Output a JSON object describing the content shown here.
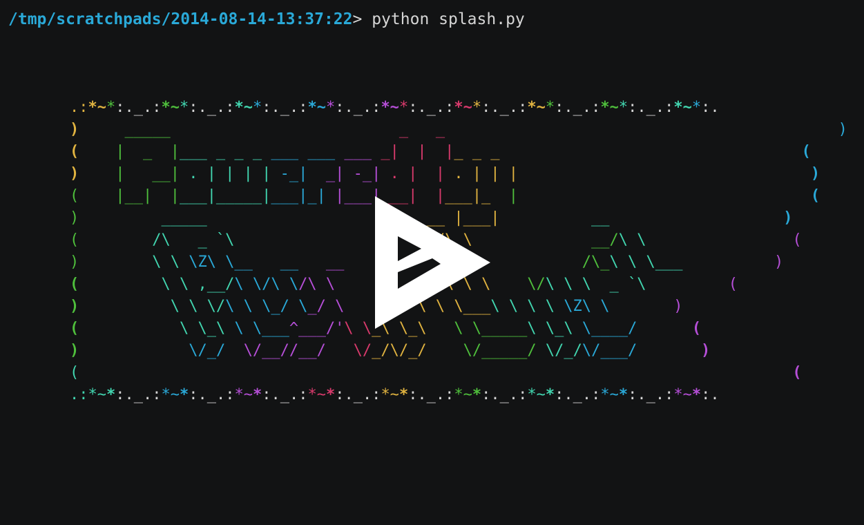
{
  "terminal": {
    "prompt_path": "/tmp/scratchpads/2014-08-14-13:37:22",
    "prompt_symbol": "> ",
    "command": "python splash.py"
  },
  "art": {
    "lines": [
      ".:*~*:._.:*~*:._.:*~*:._.:*~*:._.:*~*:._.:*~*:._.:*~*:._.:*~*:._.:*~*:.",
      ")     _____                             _   _                              )",
      "(    |  _  |___ _ _ _ ___ ___ ___ _|  |  |_ _ _                           (",
      ")    |   __| . | | | | -_|  _| -_| . |  | . | | |                          )",
      "(    |__|  |___|_____|___|_| |___|___|  |___|_  |                          (",
      ")         _____                              __ |___|          __          )",
      "(        /\\   _ `\\                          /\\ \\             __/\\ \\         (",
      ")        \\ \\ \\Z\\ \\__   __   __   __   __    \\ \\ \\           /\\_\\ \\ \\___     )",
      "(         \\ \\ ,__/\\ \\/\\ \\/\\ \\/\\ \\/\\ \\/\\ \\    \\ \\ \\    __  \\/\\ \\ \\  _ `\\   (",
      ")          \\ \\ \\/\\ \\ \\_/ \\_/ \\ \\ \\/\\ \\/\\ \\    \\ \\ \\___\\ \\ \\ \\ \\ \\Z\\ \\  )",
      "(           \\ \\_\\ \\ \\___^___/'\\ \\_\\ \\_\\ \\_\\    \\ \\_____\\ \\_\\ \\____/  (",
      ")            \\/_/  \\/__//__/   \\/_/\\/_/\\/_/     \\/_____/ \\/_/\\/___/   )",
      "(                                                                            (",
      ".:*~*:._.:*~*:._.:*~*:._.:*~*:._.:*~*:._.:*~*:._.:*~*:._.:*~*:._.:*~*:."
    ]
  },
  "player": {
    "play_icon": "play-icon",
    "color": "#ffffff"
  },
  "colors": {
    "background": "#121314",
    "prompt_path": "#2aa9d8",
    "yellow": "#e0b340",
    "green": "#4fbf3c",
    "teal": "#42d6b0",
    "blue": "#2aa9d8",
    "purple": "#b64fd8",
    "red": "#d83a6c"
  }
}
